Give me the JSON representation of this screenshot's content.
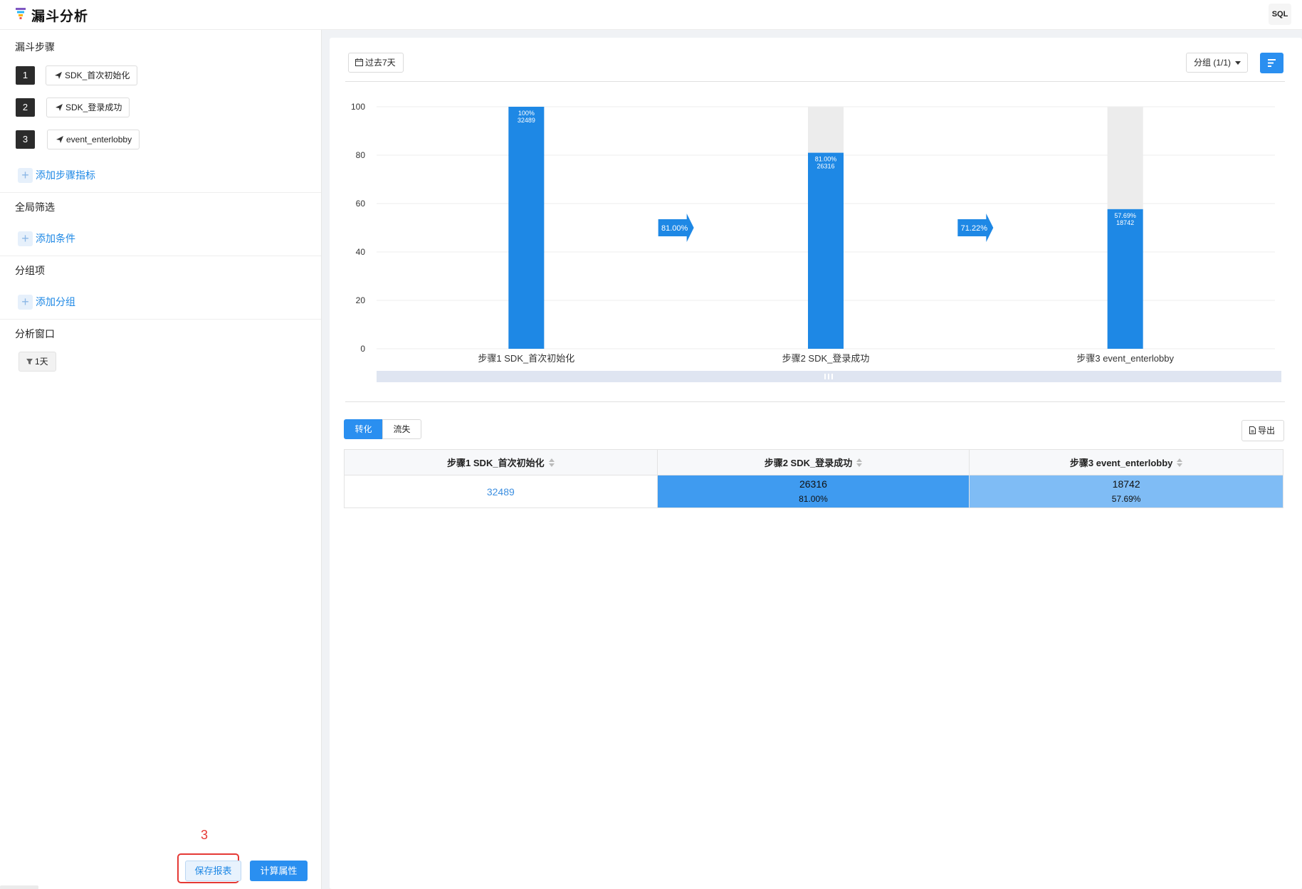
{
  "header": {
    "title": "漏斗分析",
    "sql_label": "SQL"
  },
  "sidebar": {
    "funnel_steps_title": "漏斗步骤",
    "steps": [
      {
        "num": "1",
        "label": "SDK_首次初始化"
      },
      {
        "num": "2",
        "label": "SDK_登录成功"
      },
      {
        "num": "3",
        "label": "event_enterlobby"
      }
    ],
    "add_step_metric": "添加步骤指标",
    "global_filter_title": "全局筛选",
    "add_condition": "添加条件",
    "group_title": "分组项",
    "add_group": "添加分组",
    "window_title": "分析窗口",
    "window_value": "1天",
    "annotation": "3",
    "save_label": "保存报表",
    "compute_label": "计算属性"
  },
  "toolbar": {
    "date_range": "过去7天",
    "group_select": "分组 (1/1)"
  },
  "chart_data": {
    "type": "bar",
    "categories": [
      "步骤1 SDK_首次初始化",
      "步骤2 SDK_登录成功",
      "步骤3 event_enterlobby"
    ],
    "values": [
      100,
      81.0,
      57.69
    ],
    "counts": [
      32489,
      26316,
      18742
    ],
    "bar_labels": [
      {
        "pct": "100%",
        "count": "32489"
      },
      {
        "pct": "81.00%",
        "count": "26316"
      },
      {
        "pct": "57.69%",
        "count": "18742"
      }
    ],
    "step_conversion": [
      "81.00%",
      "71.22%"
    ],
    "ylim": [
      0,
      100
    ],
    "yticks": [
      0,
      20,
      40,
      60,
      80,
      100
    ],
    "bar_color": "#1e88e5",
    "bg_color": "#ececec",
    "grid": true
  },
  "tabs": {
    "conversion": "转化",
    "loss": "流失"
  },
  "export_label": "导出",
  "table": {
    "headers": [
      "步骤1 SDK_首次初始化",
      "步骤2 SDK_登录成功",
      "步骤3 event_enterlobby"
    ],
    "row": [
      {
        "count": "32489",
        "rate": ""
      },
      {
        "count": "26316",
        "rate": "81.00%"
      },
      {
        "count": "18742",
        "rate": "57.69%"
      }
    ]
  }
}
